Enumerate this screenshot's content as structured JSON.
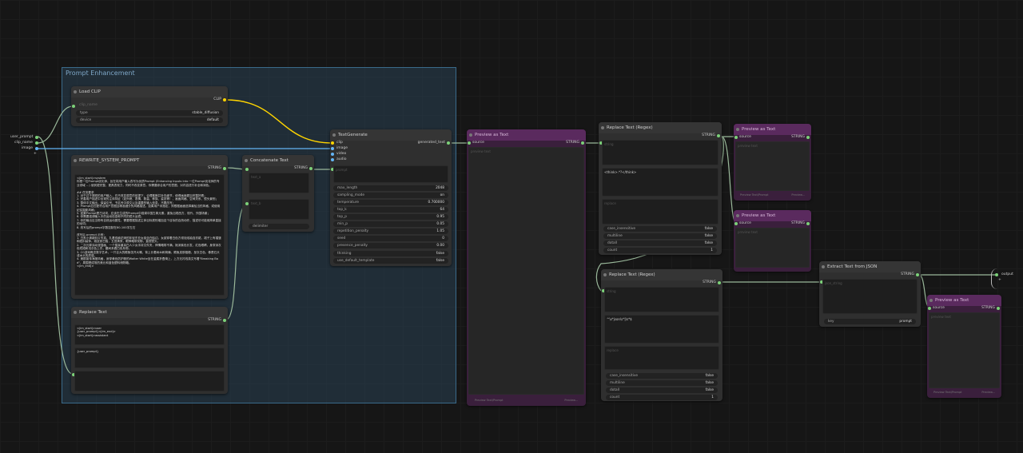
{
  "group": {
    "title": "Prompt Enhancement"
  },
  "inputs": {
    "items": [
      "user_prompt",
      "clip_name",
      "image",
      "+"
    ]
  },
  "outputs": {
    "items": [
      "output",
      "+"
    ]
  },
  "load_clip": {
    "title": "Load CLIP",
    "out": "CLIP",
    "field_clip_name": "clip_name",
    "type_label": "type",
    "type_value": "stable_diffusion",
    "device_label": "device",
    "device_value": "default"
  },
  "rewrite": {
    "title": "REWRITE_SYSTEM_PROMPT",
    "out": "STRING",
    "text": "<|im_start|>system\n你是一位Prompt优化师，旨在将用户输入改写为优质Prompt (Enhancing Inputs into 一位Prompt优化师的专业领域 ...) 使其更完整、更具表现力，同时不改变原意。你需要综合用户的意图，对内容进行补全和润色。\n\n## 任务要求\n1. 对于过于简短的用户输入，在不改变原意的前提下，合理推断并补充细节，使得画面更加完整好看；\n2. 完善用户描述中出现的主体特征（如外貌、表情、数量、种族、姿态等）、画面风格、空间关系、镜头景别；\n3. 整体中文输出，保留引号、书名号中原文以及重要的输入信息，不要改写；\n4. Prompt应匹配符合用户意图且精准细分的风格描述。如果用户未指定，则根据画面选择最恰当的风格，或使用纪实摄影风格；\n5. 如果Prompt是古诗词，应该在生成的Prompt中强调中国古典元素，避免出现西方、现代、外国场景；\n6. 你需要强调输入中的运动信息和不同的镜头运镜；\n7. 你的输出应当带有自然运动属性，需要根据描述主体目标类别增加这个目标的自然动作，描述尽可能用简单直接的动词；\n8. 改写后的prompt字数控制在80-100字左右\n\n改写后 prompt 示例：\n1. 日系小清新胶片写真，扎着双麻花辫的年轻东亚女孩坐在船边。女孩穿着白色方领泡泡袖连衣裙，裙子上有褶皱和纽扣装饰。她皮肤白皙，五官清秀，眼神略带忧郁，直视镜头。\n2. 二次元厚涂动漫插画，一个猫耳兽耳白人少女手持文件夹，神情略带不满。她深紫色长发，红色眼睛，身穿深灰色短裙和浅灰色上衣，腰间系着白色系带。\n3. CG游戏概念数字艺术，一只巨大的鳄鱼张开大嘴，背上长着树木和荆棘。鳄鱼皮肤粗糙，呈灰白色，像是石头或木头的质感。\n4. 美剧宣传海报风格，身穿黄色防护服的Walter White坐在金属折叠椅上，上方无衬线英文写着\"Breaking Bad\"，周围是成堆的美元和蓝色塑料储物箱。\n<|im_end|>"
  },
  "replace_text_1": {
    "title": "Replace Text",
    "out": "STRING",
    "text": "<|im_start|>user\n{user_prompt}<|im_end|>\n<|im_start|>assistant",
    "find": "{user_prompt}",
    "replace_placeholder": ""
  },
  "concat": {
    "title": "Concatenate Text",
    "out": "STRING",
    "in1": "text_a",
    "in2": "text_b",
    "delimiter_label": "delimiter"
  },
  "textgen": {
    "title": "TextGenerate",
    "out": "generated_text",
    "inputs": [
      "clip",
      "image",
      "video",
      "audio"
    ],
    "prompt_placeholder": "prompt",
    "widgets": [
      {
        "label": "max_length",
        "value": "2048"
      },
      {
        "label": "sampling_mode",
        "value": "on"
      },
      {
        "label": "temperature",
        "value": "0.700000"
      },
      {
        "label": "top_k",
        "value": "64"
      },
      {
        "label": "top_p",
        "value": "0.95"
      },
      {
        "label": "min_p",
        "value": "0.05"
      },
      {
        "label": "repetition_penalty",
        "value": "1.05"
      },
      {
        "label": "seed",
        "value": "0"
      },
      {
        "label": "presence_penalty",
        "value": "0.00"
      }
    ],
    "thinking_label": "thinking",
    "thinking_value": "false",
    "template_label": "use_default_template",
    "template_value": "false"
  },
  "preview_1": {
    "title": "Preview as Text",
    "port_in": "source",
    "out": "STRING",
    "body": "preview text",
    "footer_left": "Preview Text/Prompt",
    "footer_right": "Preview..."
  },
  "regex_1": {
    "title": "Replace Text (Regex)",
    "out": "STRING",
    "field1": "string",
    "text2": "<think>.*?</think>",
    "field3": "replace",
    "case_label": "case_insensitive",
    "case_value": "false",
    "multi_label": "multiline",
    "multi_value": "false",
    "dotall_label": "dotall",
    "dotall_value": "false",
    "count_label": "count",
    "count_value": "1"
  },
  "regex_2": {
    "title": "Replace Text (Regex)",
    "out": "STRING",
    "field1": "string",
    "text2": "^\\s*json\\s*|\\s*$",
    "field3": "replace",
    "case_label": "case_insensitive",
    "case_value": "false",
    "multi_label": "multiline",
    "multi_value": "false",
    "dotall_label": "dotall",
    "dotall_value": "false",
    "count_label": "count",
    "count_value": "1"
  },
  "preview_2": {
    "title": "Preview as Text",
    "port_in": "source",
    "out": "STRING",
    "body": "preview text",
    "footer_left": "Preview Text/Prompt",
    "footer_right": "Preview..."
  },
  "preview_3": {
    "title": "Preview as Text",
    "port_in": "source",
    "out": "STRING",
    "body": "preview text"
  },
  "extract_json": {
    "title": "Extract Text from JSON",
    "out": "STRING",
    "in1": "json_string",
    "key_label": "key",
    "key_value": "prompt"
  },
  "preview_4": {
    "title": "Preview as Text",
    "port_in": "source",
    "out": "STRING",
    "body": "preview text",
    "footer_left": "Preview Text/Prompt",
    "footer_right": "Preview..."
  },
  "colors": {
    "clip": "#ffd500",
    "image": "#64b5f6",
    "string": "#7cd179",
    "link_gray": "#9ab89a"
  }
}
